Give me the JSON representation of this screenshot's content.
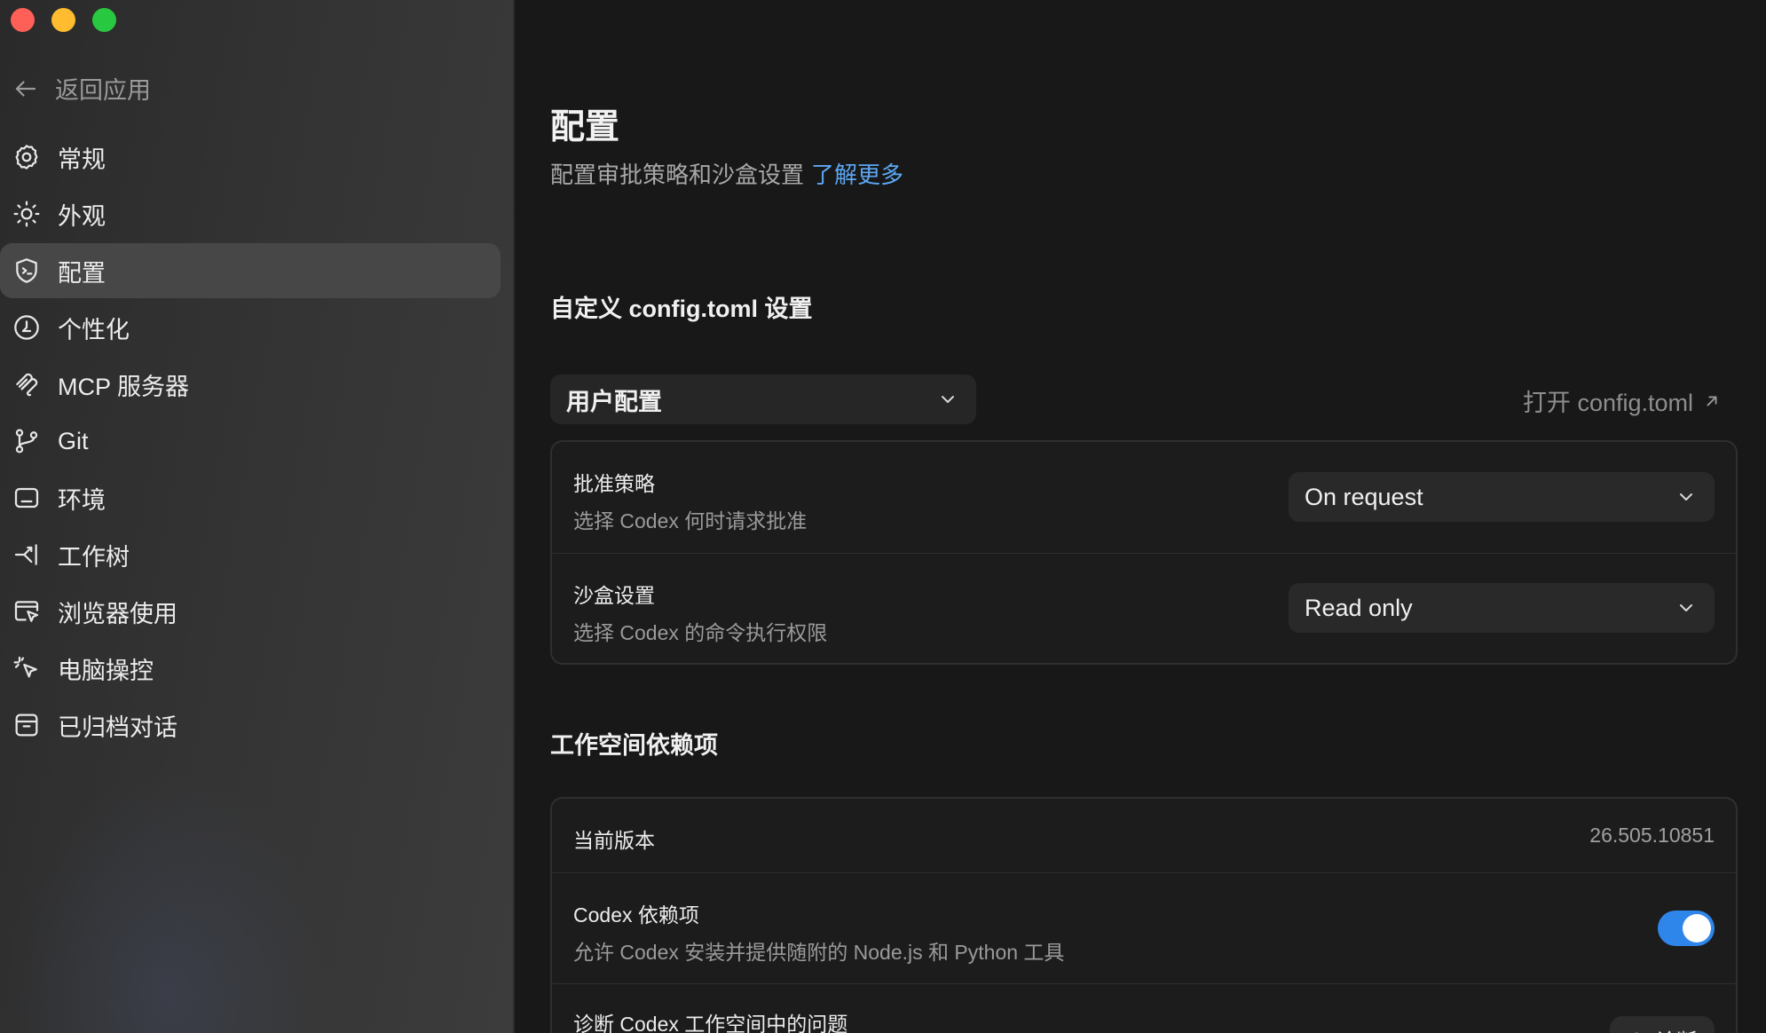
{
  "sidebar": {
    "back_label": "返回应用",
    "items": [
      {
        "label": "常规",
        "icon": "gear-icon",
        "active": false
      },
      {
        "label": "外观",
        "icon": "sun-icon",
        "active": false
      },
      {
        "label": "配置",
        "icon": "shield-terminal-icon",
        "active": true
      },
      {
        "label": "个性化",
        "icon": "personalize-icon",
        "active": false
      },
      {
        "label": "MCP 服务器",
        "icon": "mcp-icon",
        "active": false
      },
      {
        "label": "Git",
        "icon": "git-branch-icon",
        "active": false
      },
      {
        "label": "环境",
        "icon": "monitor-icon",
        "active": false
      },
      {
        "label": "工作树",
        "icon": "worktree-icon",
        "active": false
      },
      {
        "label": "浏览器使用",
        "icon": "browser-cursor-icon",
        "active": false
      },
      {
        "label": "电脑操控",
        "icon": "pointer-click-icon",
        "active": false
      },
      {
        "label": "已归档对话",
        "icon": "archive-icon",
        "active": false
      }
    ]
  },
  "main": {
    "title": "配置",
    "subtitle": "配置审批策略和沙盒设置",
    "learn_more": "了解更多",
    "config_section_title": "自定义 config.toml 设置",
    "profile_select": "用户配置",
    "open_config": "打开 config.toml",
    "approval": {
      "label": "批准策略",
      "desc": "选择 Codex 何时请求批准",
      "value": "On request"
    },
    "sandbox": {
      "label": "沙盒设置",
      "desc": "选择 Codex 的命令执行权限",
      "value": "Read only"
    },
    "deps_section_title": "工作空间依赖项",
    "current_version": {
      "label": "当前版本",
      "value": "26.505.10851"
    },
    "codex_deps": {
      "label": "Codex 依赖项",
      "desc": "允许 Codex 安装并提供随附的 Node.js 和 Python 工具",
      "enabled": true
    },
    "diagnose": {
      "label": "诊断 Codex 工作空间中的问题",
      "button": "诊断"
    }
  },
  "colors": {
    "accent": "#2f86ea",
    "link": "#5ba7f2",
    "traffic_red": "#fe5f57",
    "traffic_yellow": "#febc2e",
    "traffic_green": "#28c840"
  }
}
